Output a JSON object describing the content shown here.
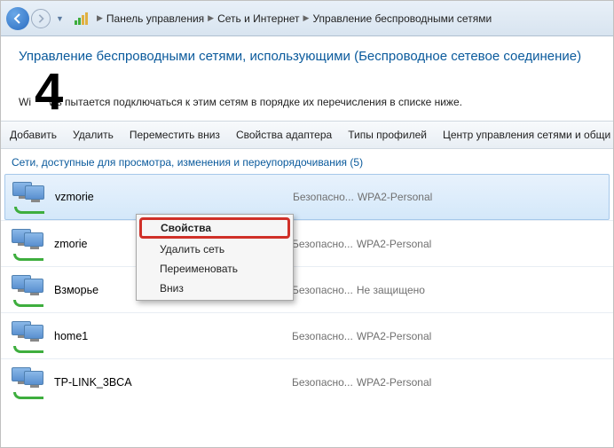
{
  "nav": {
    "crumbs": [
      "Панель управления",
      "Сеть и Интернет",
      "Управление беспроводными сетями"
    ]
  },
  "page": {
    "title": "Управление беспроводными сетями, использующими (Беспроводное сетевое соединение)",
    "annotation": "4",
    "subtitle_prefix": "Wi",
    "subtitle_suffix": "ws пытается подключаться к этим сетям в порядке их перечисления в списке ниже."
  },
  "toolbar": {
    "add": "Добавить",
    "remove": "Удалить",
    "move_down": "Переместить вниз",
    "adapter_props": "Свойства адаптера",
    "profile_types": "Типы профилей",
    "net_center": "Центр управления сетями и общи"
  },
  "section": {
    "label_text": "Сети, доступные для просмотра, изменения и переупорядочивания",
    "count": "(5)"
  },
  "networks": [
    {
      "name": "vzmorie",
      "sec_label": "Безопасно...",
      "sec_value": "WPA2-Personal",
      "selected": true
    },
    {
      "name": "zmorie",
      "sec_label": "Безопасно...",
      "sec_value": "WPA2-Personal",
      "selected": false
    },
    {
      "name": "Взморье",
      "sec_label": "Безопасно...",
      "sec_value": "Не защищено",
      "selected": false
    },
    {
      "name": "home1",
      "sec_label": "Безопасно...",
      "sec_value": "WPA2-Personal",
      "selected": false
    },
    {
      "name": "TP-LINK_3BCA",
      "sec_label": "Безопасно...",
      "sec_value": "WPA2-Personal",
      "selected": false
    }
  ],
  "context_menu": {
    "props": "Свойства",
    "delete": "Удалить сеть",
    "rename": "Переименовать",
    "down": "Вниз"
  }
}
